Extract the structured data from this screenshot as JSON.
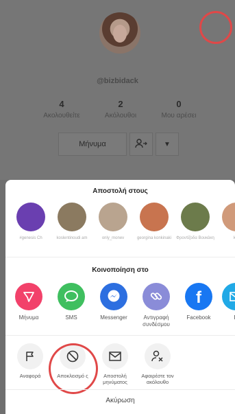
{
  "profile": {
    "username": "@bizbidack",
    "stats": [
      {
        "value": "4",
        "label": "Ακολουθείτε"
      },
      {
        "value": "2",
        "label": "Ακόλουθοι"
      },
      {
        "value": "0",
        "label": "Μου αρέσει"
      }
    ],
    "message_button": "Μήνυμα"
  },
  "share": {
    "send_to_title": "Αποστολή στους",
    "friends": [
      {
        "name": "#genesis Ch",
        "color": "#6a3fb0"
      },
      {
        "name": "koslentinoudi am",
        "color": "#8b7a60"
      },
      {
        "name": "only_monev",
        "color": "#b9a48f"
      },
      {
        "name": "georgina konkinaki",
        "color": "#c8744f"
      },
      {
        "name": "Φροντίζοδα Βουκάκη",
        "color": "#6c7b4b"
      },
      {
        "name": "kar",
        "color": "#d09a7a"
      }
    ],
    "share_to_title": "Κοινοποίηση στο",
    "apps": [
      {
        "label": "Μήνυμα",
        "color": "#f2416a"
      },
      {
        "label": "SMS",
        "color": "#3fbf5f"
      },
      {
        "label": "Messenger",
        "color": "#2d6fe0"
      },
      {
        "label": "Αντιγραφή συνδέσμου",
        "color": "#8a8cd8"
      },
      {
        "label": "Facebook",
        "color": "#1877f2"
      },
      {
        "label": "E",
        "color": "#21a9e6"
      }
    ],
    "actions": [
      {
        "label": "Αναφορά"
      },
      {
        "label": "Αποκλεισμό ς"
      },
      {
        "label": "Αποστολή μηνύματος"
      },
      {
        "label": "Αφαιρέστε τον ακόλουθο"
      }
    ],
    "cancel": "Ακύρωση"
  }
}
